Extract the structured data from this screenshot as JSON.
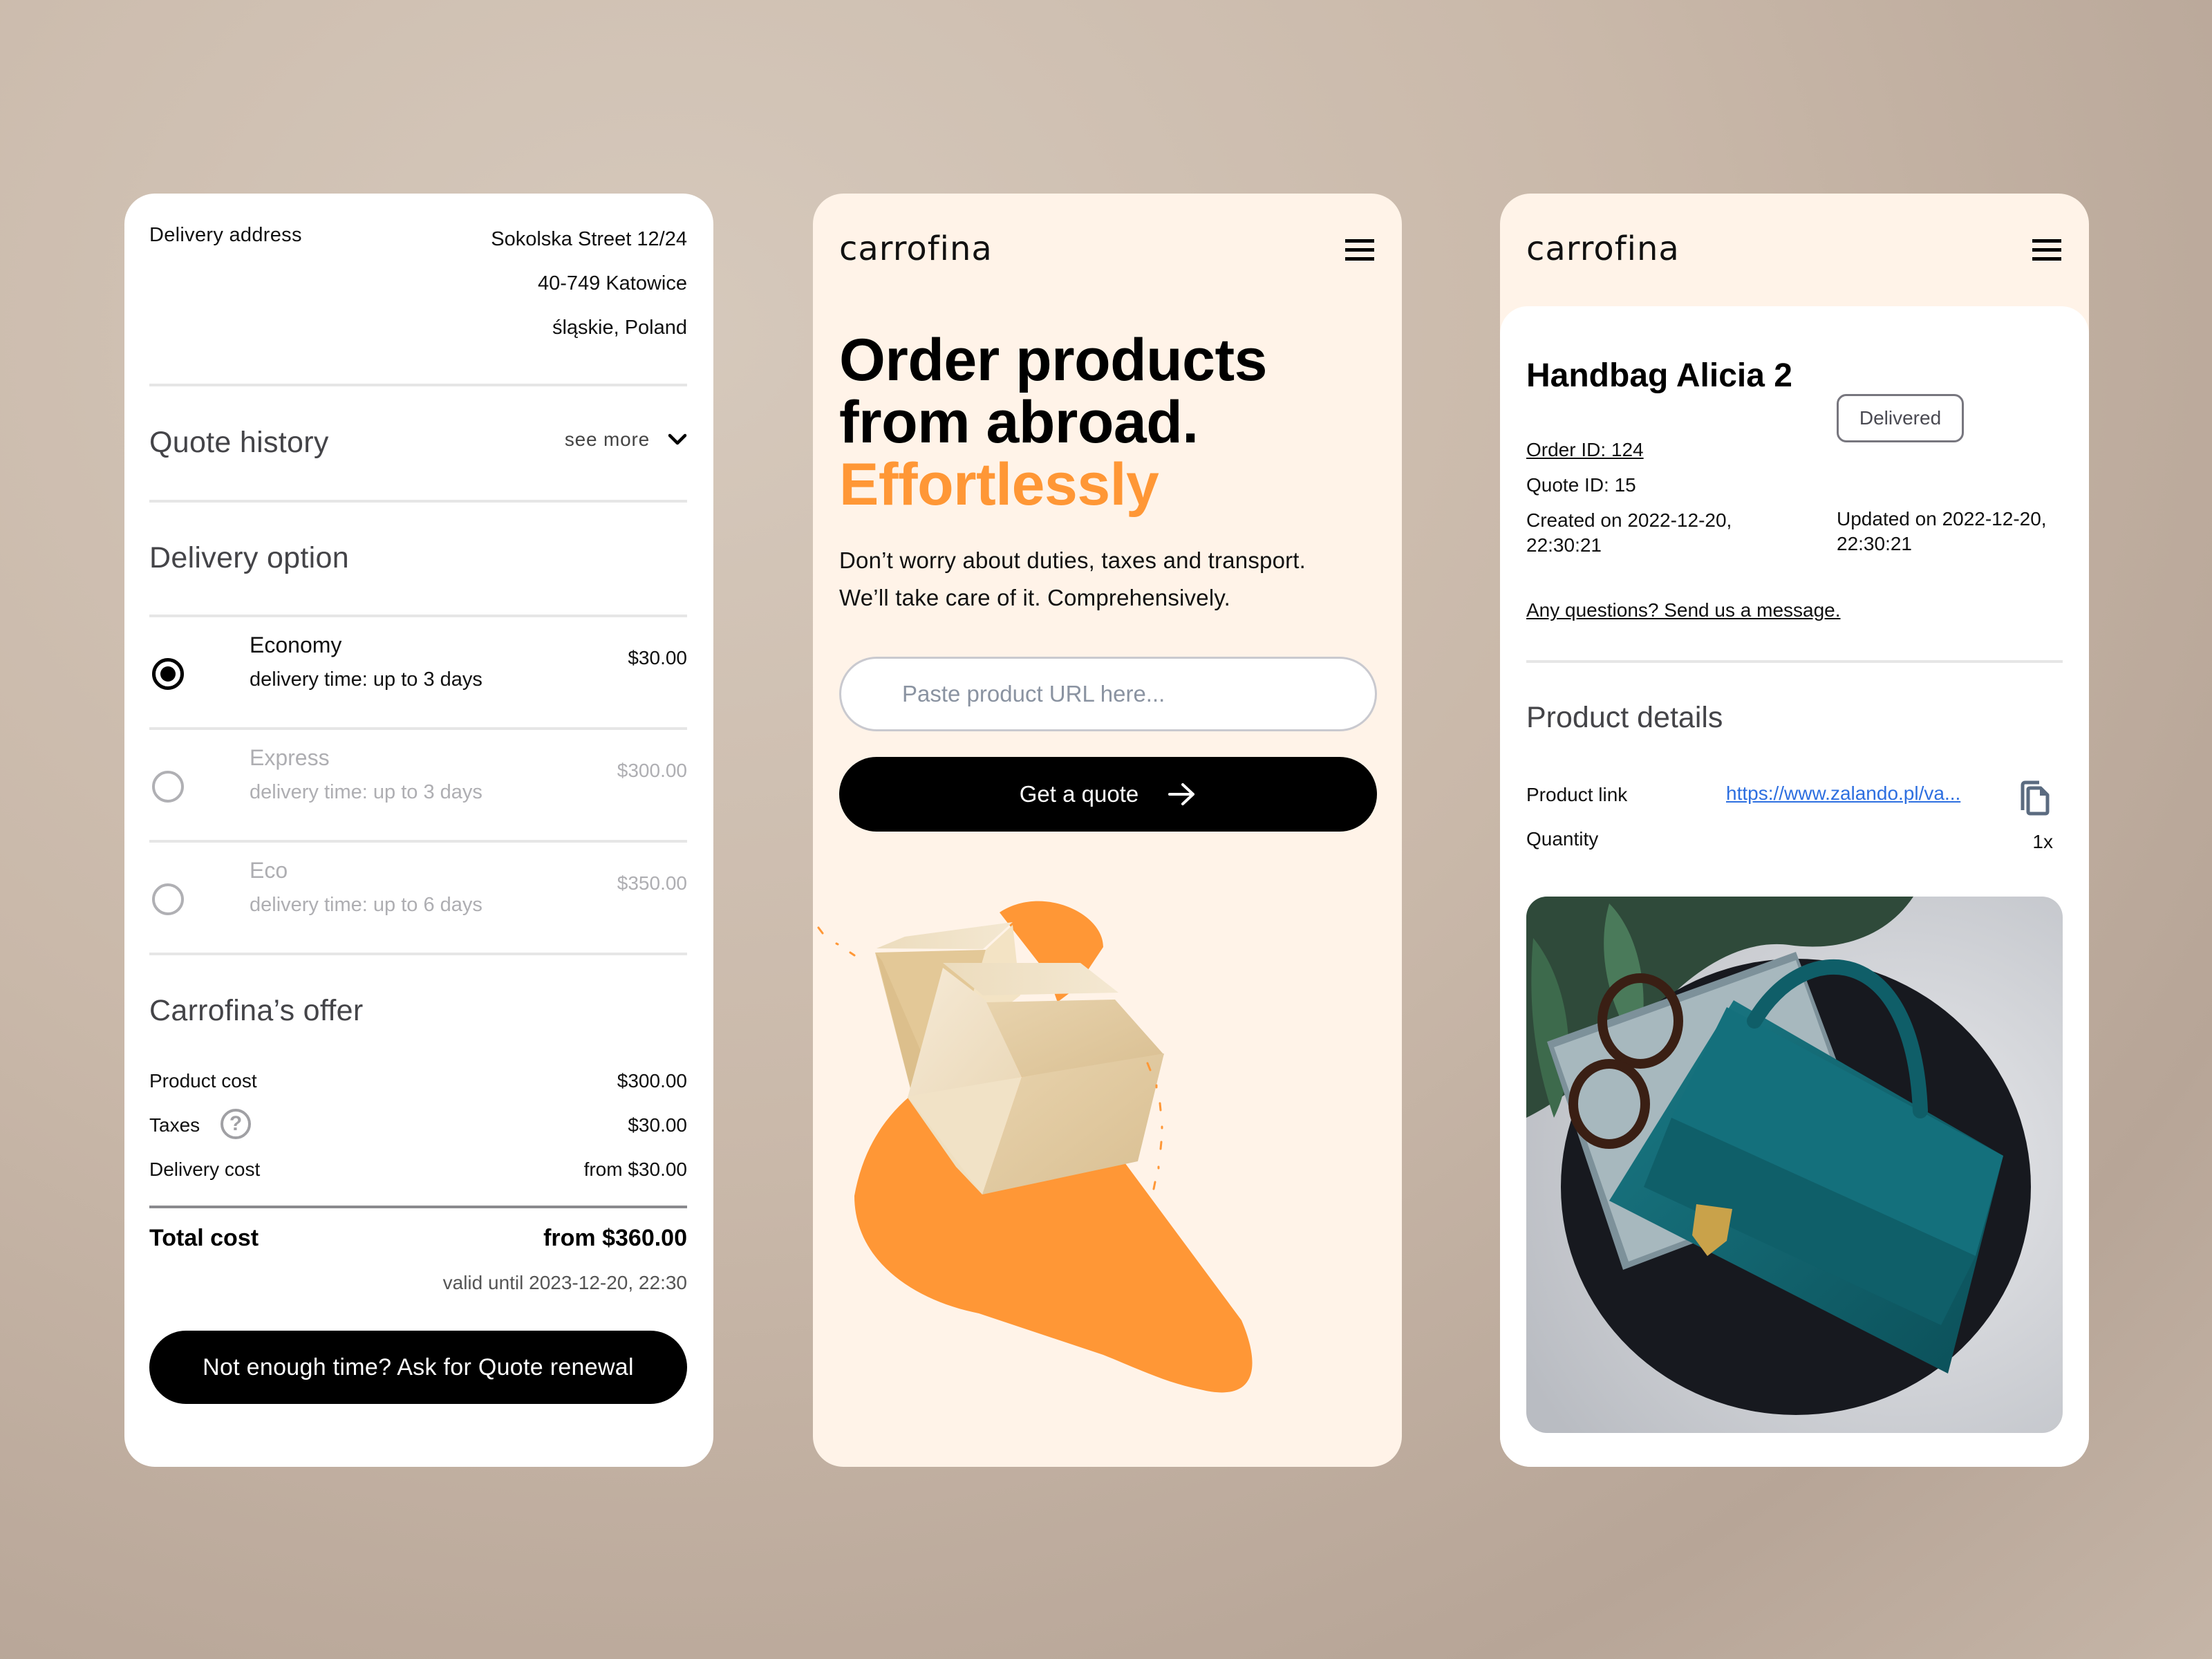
{
  "colors": {
    "accent_orange": "#ff9736",
    "cream": "#fff3e8",
    "link_blue": "#2d6fe0",
    "text_dark": "#111111",
    "text_muted": "#aeaeb2"
  },
  "quote_screen": {
    "delivery_address": {
      "label": "Delivery address",
      "lines": [
        "Sokolska Street 12/24",
        "40-749 Katowice",
        "śląskie, Poland"
      ]
    },
    "quote_history": {
      "title": "Quote history",
      "see_more_label": "see more",
      "icon": "chevron-down-icon"
    },
    "delivery_option": {
      "title": "Delivery option",
      "options": [
        {
          "name": "Economy",
          "detail": "delivery time: up to 3 days",
          "price": "$30.00",
          "selected": true
        },
        {
          "name": "Express",
          "detail": "delivery time: up to 3 days",
          "price": "$300.00",
          "selected": false
        },
        {
          "name": "Eco",
          "detail": "delivery time: up to 6 days",
          "price": "$350.00",
          "selected": false
        }
      ]
    },
    "offer": {
      "title": "Carrofina’s offer",
      "rows": [
        {
          "label": "Product cost",
          "value": "$300.00"
        },
        {
          "label": "Taxes",
          "value": "$30.00",
          "icon": "help-circle-icon"
        },
        {
          "label": "Delivery cost",
          "value": "from $30.00"
        }
      ],
      "total_label": "Total cost",
      "total_value": "from $360.00",
      "valid_until": "valid until 2023-12-20, 22:30",
      "renew_button": "Not enough time? Ask for Quote renewal"
    }
  },
  "home_screen": {
    "logo": "carrofina",
    "menu_icon": "hamburger-menu-icon",
    "headline_line1": "Order products",
    "headline_line2": "from abroad.",
    "headline_accent": "Effortlessly",
    "body_line1": "Don’t worry about duties, taxes and transport.",
    "body_line2": "We’ll take care of it. Comprehensively.",
    "url_input": {
      "placeholder": "Paste product URL here...",
      "value": ""
    },
    "quote_button": "Get a quote",
    "quote_button_icon": "arrow-right-icon",
    "illustration": "cardboard-boxes-illustration"
  },
  "order_screen": {
    "logo": "carrofina",
    "menu_icon": "hamburger-menu-icon",
    "product_title": "Handbag Alicia 2",
    "order_id": "Order ID: 124",
    "quote_id": "Quote ID: 15",
    "created_line1": "Created on 2022-12-20,",
    "created_line2": "22:30:21",
    "status": "Delivered",
    "updated_line1": "Updated on 2022-12-20,",
    "updated_line2": "22:30:21",
    "message_link": "Any questions? Send us a message.",
    "product_details": {
      "title": "Product details",
      "link_label": "Product link",
      "link_value": "https://www.zalando.pl/va...",
      "copy_icon": "copy-icon",
      "quantity_label": "Quantity",
      "quantity_value": "1x"
    },
    "image": "teal-handbag-photo"
  }
}
